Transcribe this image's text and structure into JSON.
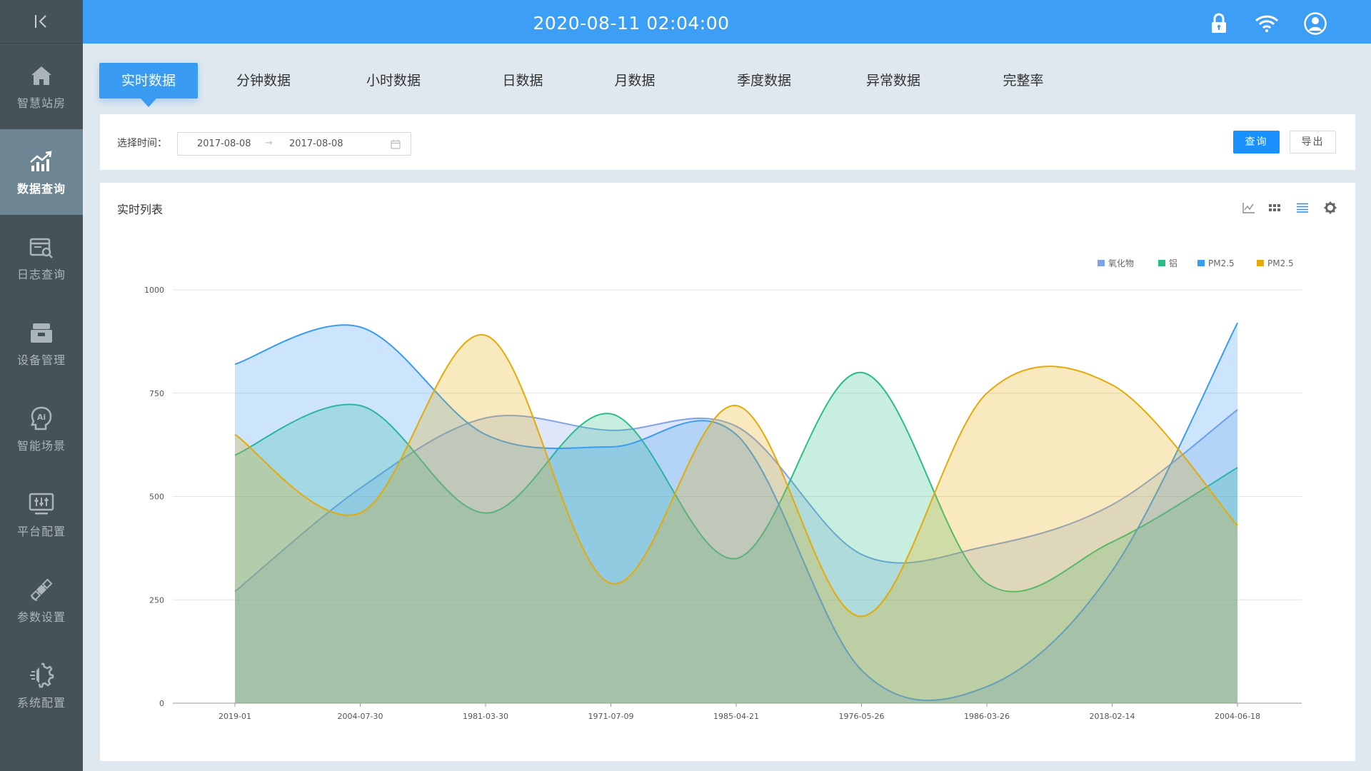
{
  "header": {
    "datetime": "2020-08-11  02:04:00"
  },
  "sidebar": {
    "items": [
      {
        "label": "智慧站房",
        "icon": "home-icon"
      },
      {
        "label": "数据查询",
        "icon": "trend-chart-icon",
        "active": true
      },
      {
        "label": "日志查询",
        "icon": "log-search-icon"
      },
      {
        "label": "设备管理",
        "icon": "device-icon"
      },
      {
        "label": "智能场景",
        "icon": "ai-head-icon"
      },
      {
        "label": "平台配置",
        "icon": "monitor-sliders-icon"
      },
      {
        "label": "参数设置",
        "icon": "satellite-icon"
      },
      {
        "label": "系统配置",
        "icon": "gear-chip-icon"
      }
    ]
  },
  "tabs": [
    {
      "label": "实时数据",
      "active": true
    },
    {
      "label": "分钟数据"
    },
    {
      "label": "小时数据"
    },
    {
      "label": "日数据"
    },
    {
      "label": "月数据"
    },
    {
      "label": "季度数据"
    },
    {
      "label": "异常数据"
    },
    {
      "label": "完整率"
    }
  ],
  "filter": {
    "label": "选择时间：",
    "start_date": "2017-08-08",
    "separator": "→",
    "end_date": "2017-08-08",
    "query_label": "查询",
    "export_label": "导出"
  },
  "panel": {
    "title": "实时列表"
  },
  "colors": {
    "accent": "#3d9ef5",
    "sidebar": "#465259",
    "sidebar_active": "#6e8693"
  },
  "chart_data": {
    "type": "area",
    "categories": [
      "2019-01",
      "2004-07-30",
      "1981-03-30",
      "1971-07-09",
      "1985-04-21",
      "1976-05-26",
      "1986-03-26",
      "2018-02-14",
      "2004-06-18"
    ],
    "ylim": [
      0,
      1000
    ],
    "yticks": [
      0,
      250,
      500,
      750,
      1000
    ],
    "grid": true,
    "legend_position": "top-right",
    "series": [
      {
        "name": "氧化物",
        "color": "#7ea2e8",
        "values": [
          270,
          520,
          690,
          660,
          670,
          360,
          380,
          480,
          710
        ]
      },
      {
        "name": "铝",
        "color": "#2bbd86",
        "values": [
          600,
          720,
          460,
          700,
          350,
          800,
          290,
          390,
          570
        ]
      },
      {
        "name": "PM2.5",
        "color": "#3a9bf3",
        "values": [
          820,
          910,
          650,
          620,
          650,
          80,
          40,
          320,
          920
        ]
      },
      {
        "name": "PM2.5",
        "color": "#e3aa08",
        "values": [
          650,
          460,
          890,
          290,
          720,
          210,
          750,
          770,
          430
        ]
      }
    ]
  }
}
